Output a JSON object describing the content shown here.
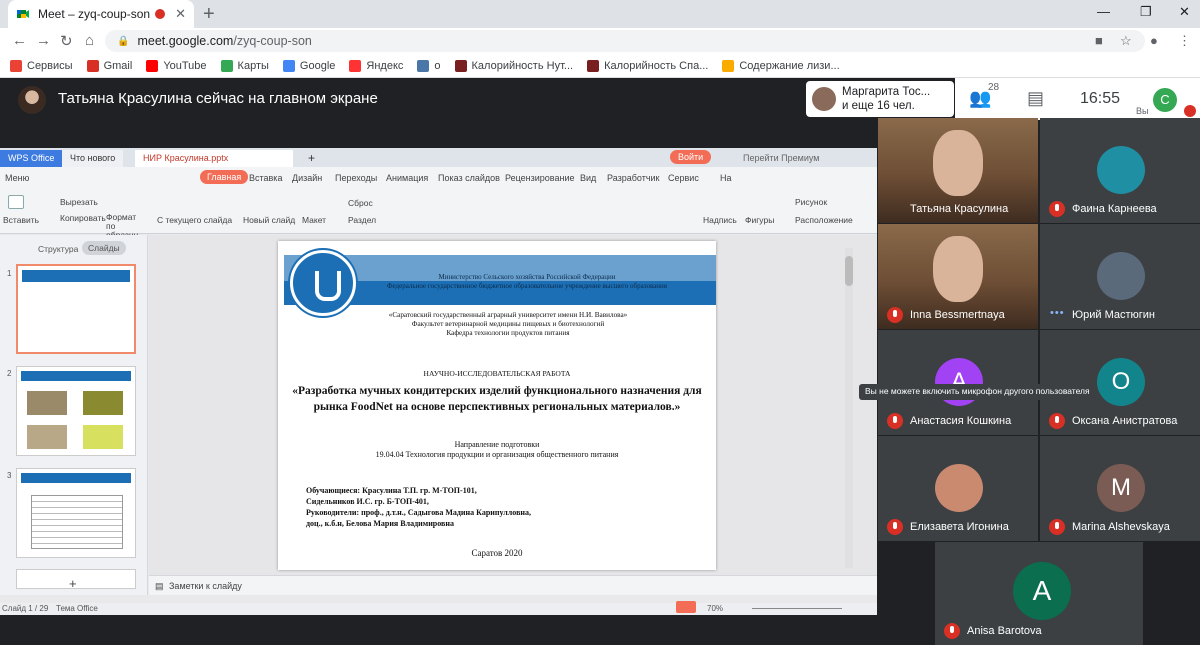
{
  "browser": {
    "tab_title": "Meet – zyq-coup-son",
    "tab_close": "✕",
    "new_tab": "+",
    "url_domain": "meet.google.com",
    "url_path": "/zyq-coup-son",
    "bookmarks": [
      {
        "label": "Сервисы",
        "color": "#ea4335"
      },
      {
        "label": "Gmail",
        "color": "#d93025"
      },
      {
        "label": "YouTube",
        "color": "#ff0000"
      },
      {
        "label": "Карты",
        "color": "#34a853"
      },
      {
        "label": "Google",
        "color": "#4285f4"
      },
      {
        "label": "Яндекс",
        "color": "#ff3333"
      },
      {
        "label": "о",
        "color": "#4a76a8"
      },
      {
        "label": "Калорийность Нут...",
        "color": "#7a1f1f"
      },
      {
        "label": "Калорийность Спа...",
        "color": "#7a1f1f"
      },
      {
        "label": "Содержание лизи...",
        "color": "#f9ab00"
      }
    ]
  },
  "meet": {
    "presenter_text": "Татьяна Красулина сейчас на главном экране",
    "pill_line1": "Маргарита Тос...",
    "pill_line2": "и еще 16 чел.",
    "participants_count": "28",
    "clock": "16:55",
    "self_initial": "C",
    "self_label": "Вы",
    "tooltip": "Вы не можете включить микрофон другого пользователя",
    "participants": [
      {
        "name": "Татьяна Красулина",
        "initial": "",
        "color": "",
        "muted": false,
        "type": "video"
      },
      {
        "name": "Фаина Карнеева",
        "initial": "",
        "color": "#1f8fa3",
        "muted": true,
        "type": "image"
      },
      {
        "name": "Inna Bessmertnaya",
        "initial": "",
        "color": "",
        "muted": true,
        "type": "video"
      },
      {
        "name": "Юрий Мастюгин",
        "initial": "",
        "color": "#5a6a7a",
        "muted": false,
        "type": "image"
      },
      {
        "name": "Анастасия Кошкина",
        "initial": "А",
        "color": "#a142f4",
        "muted": true,
        "type": "letter"
      },
      {
        "name": "Оксана Анистратова",
        "initial": "О",
        "color": "#12858c",
        "muted": true,
        "type": "letter"
      },
      {
        "name": "Елизавета Игонина",
        "initial": "",
        "color": "#c98a70",
        "muted": true,
        "type": "image"
      },
      {
        "name": "Marina Alshevskaya",
        "initial": "M",
        "color": "#7b5c55",
        "muted": true,
        "type": "letter"
      },
      {
        "name": "Anisa Barotova",
        "initial": "A",
        "color": "#0b6e4f",
        "muted": true,
        "type": "letter"
      }
    ]
  },
  "wps": {
    "app_tab": "WPS Office",
    "news_tab": "Что нового",
    "doc_tab": "НИР Красулина.pptx",
    "login_btn": "Войти",
    "rehearsal": "Перейти Премиум",
    "menu": "Меню",
    "ribbon_tabs": [
      "Главная",
      "Вставка",
      "Дизайн",
      "Переходы",
      "Анимация",
      "Показ слайдов",
      "Рецензирование",
      "Вид",
      "Разработчик",
      "Сервис"
    ],
    "search": "На",
    "ribbon": {
      "paste": "Вставить",
      "cut": "Вырезать",
      "copy": "Копировать",
      "format": "Формат по образцу",
      "from_current": "С текущего слайда",
      "new_slide": "Новый слайд",
      "layout": "Макет",
      "reset": "Сброс",
      "section": "Раздел",
      "picture": "Рисунок",
      "label": "Надпись",
      "shapes": "Фигуры",
      "arrange": "Расположение"
    },
    "panel_tabs": [
      "Структура",
      "Слайды"
    ],
    "thumb_numbers": [
      "1",
      "2",
      "3"
    ],
    "add_slide": "+",
    "notes": "Заметки к слайду",
    "status_slide": "Слайд 1 / 29",
    "status_theme": "Тема Office",
    "zoom": "70%"
  },
  "slide": {
    "ministry": "Министерство Сельского хозяйства Российской Федерации\nФедеральное государственное бюджетное образовательное учреждение высшего образования",
    "university": "«Саратовский государственный аграрный университет имени Н.И. Вавилова»\nФакультет ветеринарной медицины пищевых и биотехнологий\nКафедра технологии продуктов питания",
    "kind": "НАУЧНО-ИССЛЕДОВАТЕЛЬСКАЯ РАБОТА",
    "title": "«Разработка мучных кондитерских изделий функционального назначения для рынка FoodNet на основе перспективных региональных материалов.»",
    "direction_label": "Направление подготовки",
    "direction": "19.04.04 Технология продукции и организация общественного питания",
    "students": "Обучающиеся: Красулина Т.П. гр. М-ТОП-101,",
    "students2": "Сидельников И.С. гр. Б-ТОП-401,",
    "supervisors": "Руководители: проф., д.т.н., Садыгова Мадина Карипулловна,",
    "supervisors2": "доц., к.б.н, Белова Мария Владимировна",
    "city": "Саратов 2020"
  }
}
